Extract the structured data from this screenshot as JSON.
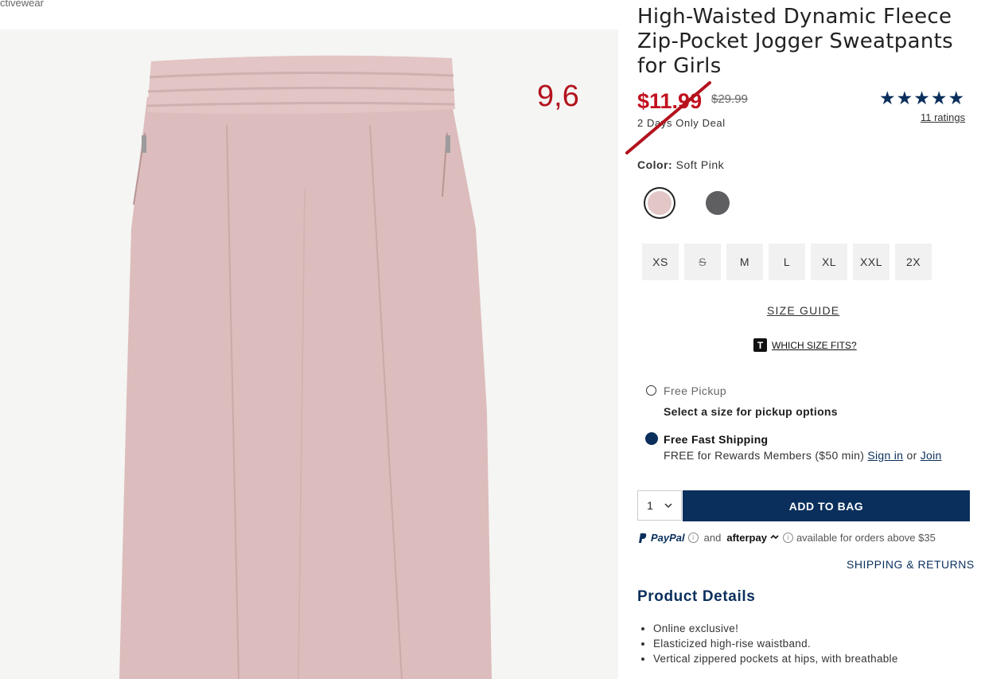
{
  "breadcrumb": "ctivewear",
  "photo": {
    "alt": "",
    "annotation": "9,6"
  },
  "product": {
    "title": "High-Waisted Dynamic Fleece Zip-Pocket Jogger Sweatpants for Girls",
    "price": "$11.99",
    "was_price": "$29.99",
    "deal": "2 Days Only Deal",
    "stars": "★★★★★",
    "ratings": "11 ratings"
  },
  "color": {
    "label": "Color:",
    "value": "Soft Pink",
    "swatches": [
      "#e2c7c6",
      "#5f5e60"
    ]
  },
  "sizes": [
    {
      "label": "XS",
      "available": true
    },
    {
      "label": "S",
      "available": false
    },
    {
      "label": "M",
      "available": true
    },
    {
      "label": "L",
      "available": true
    },
    {
      "label": "XL",
      "available": true
    },
    {
      "label": "XXL",
      "available": true
    },
    {
      "label": "2X",
      "available": true
    }
  ],
  "size_guide": "SIZE GUIDE",
  "which_size": {
    "badge": "T",
    "label": "WHICH SIZE FITS?"
  },
  "fulfillment": {
    "pickup_label": "Free Pickup",
    "pickup_note": "Select a size for pickup options",
    "shipping_label": "Free Fast Shipping",
    "shipping_note_pre": "FREE for Rewards Members ($50 min)",
    "sign_in": "Sign in",
    "or": "or",
    "join": "Join"
  },
  "cart": {
    "qty": "1",
    "add_to_bag": "ADD TO BAG"
  },
  "payment": {
    "paypal": "PayPal",
    "and": "and",
    "afterpay": "afterpay",
    "note": "available for orders above $35"
  },
  "shipping_returns": "SHIPPING & RETURNS",
  "details": {
    "title": "Product Details",
    "items": [
      "Online exclusive!",
      "Elasticized high-rise waistband.",
      "Vertical zippered pockets at hips, with breathable"
    ]
  }
}
